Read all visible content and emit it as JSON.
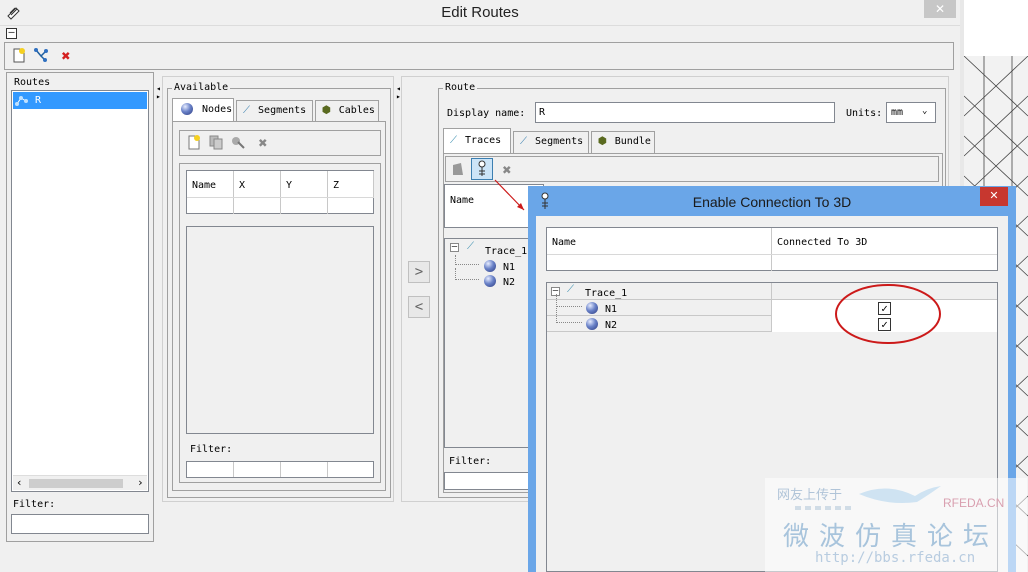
{
  "window": {
    "title": "Edit Routes",
    "minimize_symbol": "–",
    "close_symbol": "✕"
  },
  "toolbar": {
    "new_icon": "new-route-icon",
    "link_icon": "route-network-icon",
    "delete_icon": "delete-icon"
  },
  "routes_panel": {
    "title": "Routes",
    "items": [
      "R"
    ],
    "filter_label": "Filter:"
  },
  "available": {
    "title": "Available",
    "tabs": [
      "Nodes",
      "Segments",
      "Cables"
    ],
    "columns": [
      "Name",
      "X",
      "Y",
      "Z"
    ],
    "filter_label": "Filter:"
  },
  "route": {
    "title": "Route",
    "display_name_label": "Display name:",
    "display_name_value": "R",
    "units_label": "Units:",
    "units_value": "mm",
    "tabs": [
      "Traces",
      "Segments",
      "Bundle"
    ],
    "columns": [
      "Name"
    ],
    "tree": {
      "trace": "Trace_1",
      "nodes": [
        "N1",
        "N2"
      ]
    },
    "filter_label": "Filter:"
  },
  "transfer": {
    "add_symbol": ">",
    "remove_symbol": "<"
  },
  "dialog": {
    "title": "Enable Connection To 3D",
    "close_symbol": "✕",
    "columns": [
      "Name",
      "Connected To 3D"
    ],
    "tree": {
      "trace": "Trace_1",
      "nodes": [
        "N1",
        "N2"
      ]
    },
    "checks": [
      true,
      true
    ],
    "check_mark": "✓"
  },
  "watermark": {
    "line1": "网友上传于",
    "brand": "RFEDA.CN",
    "chinese": "微波仿真论坛",
    "url": "http://bbs.rfeda.cn"
  },
  "colors": {
    "selection": "#3399ff",
    "dialog_frame": "#6aa6e8",
    "annotation": "#cc1a1a",
    "window_close": "#c7c7c7"
  }
}
